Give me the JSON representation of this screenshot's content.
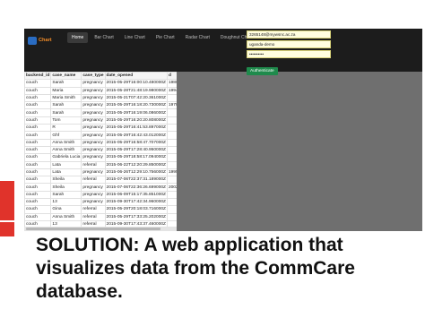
{
  "navbar": {
    "brand": "Chart",
    "links": [
      "Home",
      "Bar Chart",
      "Line Chart",
      "Pie Chart",
      "Radar Chart",
      "Doughnut Chart"
    ],
    "active_link": "Home"
  },
  "login": {
    "email": "3265148@mywsnc.ac.za",
    "domain": "uganda-demo",
    "password": "••••••••••",
    "button": "Authenticate"
  },
  "table": {
    "columns": [
      "backend_id",
      "case_name",
      "case_type",
      "date_opened",
      "d"
    ],
    "rows": [
      [
        "couch",
        "Sarah",
        "pregnancy",
        "2015-05-29T16:00:10.480000Z",
        "1980-"
      ],
      [
        "couch",
        "Maria",
        "pregnancy",
        "2015-05-28T21:48:19.980000Z",
        "1994-"
      ],
      [
        "couch",
        "Maria Smith",
        "pregnancy",
        "2015-05-21T07:42:20.361000Z",
        ""
      ],
      [
        "couch",
        "Sarah",
        "pregnancy",
        "2015-05-29T16:18:20.730000Z",
        "1970-"
      ],
      [
        "couch",
        "Sarah",
        "pregnancy",
        "2015-05-29T16:19:06.086000Z",
        ""
      ],
      [
        "couch",
        "Tom",
        "pregnancy",
        "2015-05-29T16:20:20.808000Z",
        ""
      ],
      [
        "couch",
        "R",
        "pregnancy",
        "2015-05-29T16:41:53.897000Z",
        ""
      ],
      [
        "couch",
        "Ghf",
        "pregnancy",
        "2015-05-29T16:42:43.012000Z",
        ""
      ],
      [
        "couch",
        "Anna Smith",
        "pregnancy",
        "2015-05-29T16:58:47.707000Z",
        ""
      ],
      [
        "couch",
        "Anna Smith",
        "pregnancy",
        "2015-05-29T17:28:40.950000Z",
        ""
      ],
      [
        "couch",
        "Gabriela Lucia",
        "pregnancy",
        "2015-05-29T18:58:17.094000Z",
        ""
      ],
      [
        "couch",
        "Lata",
        "referral",
        "2015-06-22T12:20:29.850000Z",
        ""
      ],
      [
        "couch",
        "Lata",
        "pregnancy",
        "2015-06-26T12:29:10.756000Z",
        "1995-"
      ],
      [
        "couch",
        "Sheila",
        "referral",
        "2015-07-06T22:37:31.189000Z",
        ""
      ],
      [
        "couch",
        "Sheila",
        "pregnancy",
        "2015-07-06T22:36:26.699000Z",
        "2002-"
      ],
      [
        "couch",
        "Sarah",
        "pregnancy",
        "2015-06-09T15:17:35.851000Z",
        ""
      ],
      [
        "couch",
        "13",
        "pregnancy",
        "2015-09-30T17:42:34.960000Z",
        ""
      ],
      [
        "couch",
        "Gina",
        "referral",
        "2015-05-29T20:18:03.716000Z",
        ""
      ],
      [
        "couch",
        "Anna Smith",
        "referral",
        "2015-05-29T17:33:25.202000Z",
        ""
      ],
      [
        "couch",
        "13",
        "referral",
        "2015-09-30T17:43:37.460000Z",
        ""
      ]
    ]
  },
  "caption": "SOLUTION: A web application that visualizes data from the CommCare database.",
  "colors": {
    "accent_red": "#e0332b",
    "navbar": "#1c1c1c",
    "auth_button": "#1f8a4c",
    "brand_orange": "#f28c28"
  }
}
